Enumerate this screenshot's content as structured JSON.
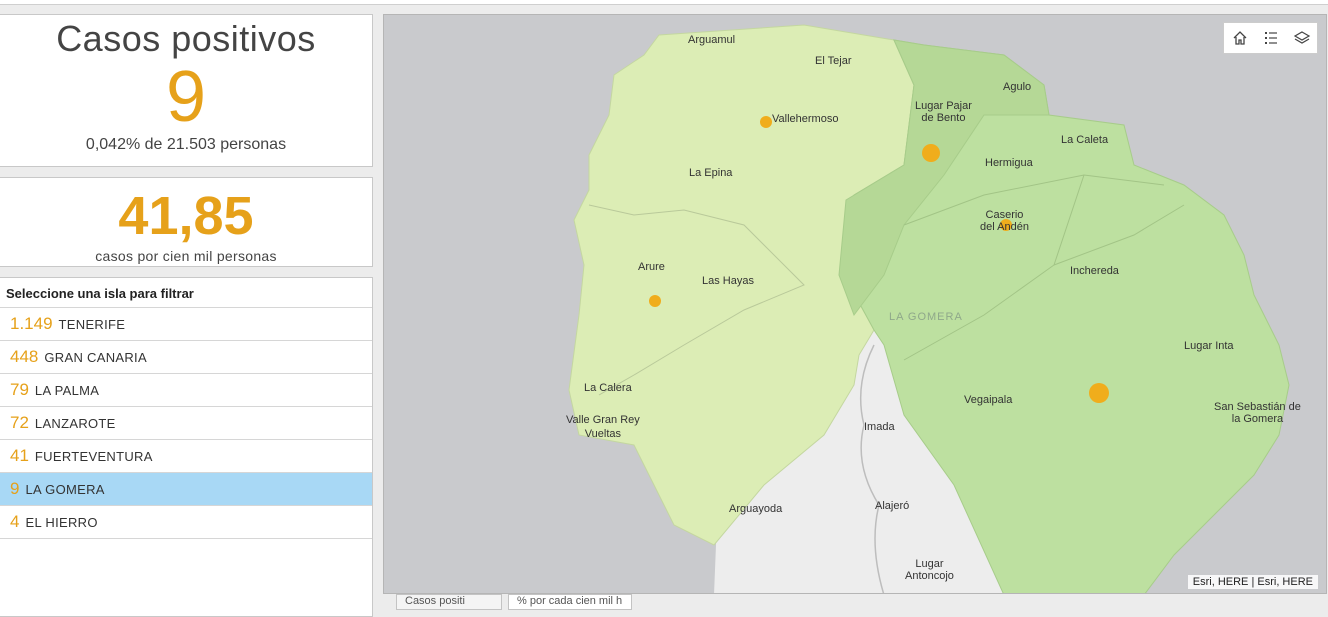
{
  "cases": {
    "title": "Casos positivos",
    "value": "9",
    "subtitle": "0,042% de 21.503 personas"
  },
  "rate": {
    "value": "41,85",
    "subtitle": "casos por cien mil personas"
  },
  "islands": {
    "title": "Seleccione una isla para filtrar",
    "items": [
      {
        "count": "1.149",
        "name": "TENERIFE",
        "selected": false
      },
      {
        "count": "448",
        "name": "GRAN CANARIA",
        "selected": false
      },
      {
        "count": "79",
        "name": "LA PALMA",
        "selected": false
      },
      {
        "count": "72",
        "name": "LANZAROTE",
        "selected": false
      },
      {
        "count": "41",
        "name": "FUERTEVENTURA",
        "selected": false
      },
      {
        "count": "9",
        "name": "LA GOMERA",
        "selected": true
      },
      {
        "count": "4",
        "name": "EL HIERRO",
        "selected": false
      }
    ]
  },
  "map": {
    "place_labels": {
      "arguamul": "Arguamul",
      "el_tejar": "El Tejar",
      "agulo": "Agulo",
      "lugar_pajar": "Lugar Pajar\nde Bento",
      "vallehermoso": "Vallehermoso",
      "la_caleta": "La Caleta",
      "hermigua": "Hermigua",
      "la_epina": "La Epina",
      "caserio": "Caserio\ndel Andén",
      "arure": "Arure",
      "las_hayas": "Las Hayas",
      "inchereda": "Inchereda",
      "la_gomera": "LA GOMERA",
      "lugar_inta": "Lugar Inta",
      "la_calera": "La Calera",
      "valle_gran_rey": "Valle Gran Rey\nVueltas",
      "vegaipala": "Vegaipala",
      "san_sebastian": "San Sebastián de\nla Gomera",
      "imada": "Imada",
      "arguayoda": "Arguayoda",
      "alajero": "Alajeró",
      "lugar_antoncojo": "Lugar\nAntoncojo"
    },
    "attribution": "Esri, HERE | Esri, HERE",
    "tools": [
      "home-icon",
      "list-icon",
      "layers-icon"
    ],
    "colors": {
      "background": "#c9cacd",
      "light_region": "#dcedb5",
      "mid_region": "#bde0a0",
      "point": "#f0ad1c",
      "south_land": "#ededed"
    }
  },
  "tabs": [
    "Casos positi",
    "% por cada cien mil h"
  ]
}
